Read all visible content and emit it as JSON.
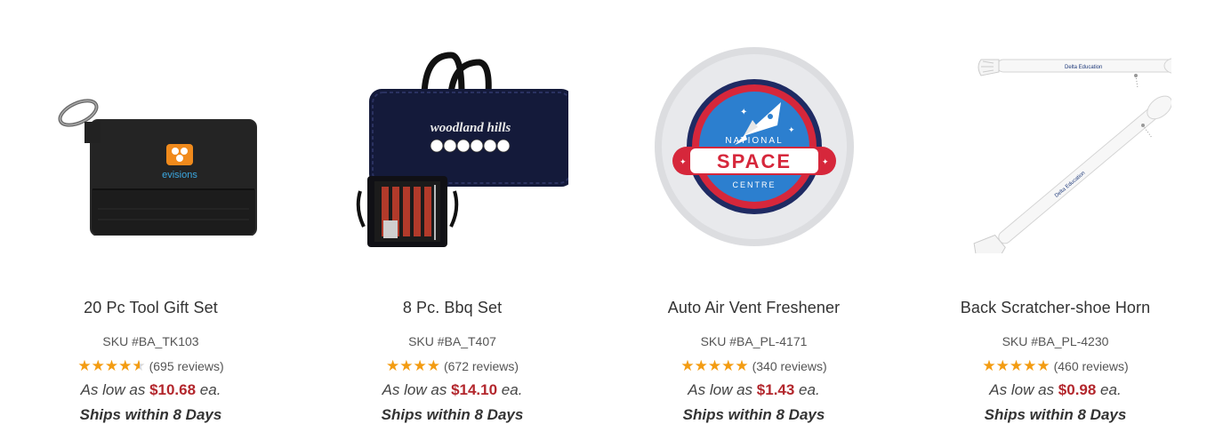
{
  "products": [
    {
      "title": "20 Pc Tool Gift Set",
      "sku": "SKU #BA_TK103",
      "rating": 4.5,
      "reviews": "(695 reviews)",
      "price_prefix": "As low as ",
      "price": "$10.68",
      "price_suffix": " ea.",
      "shipping": "Ships within 8 Days",
      "image_icon": "tool-pouch-image",
      "brand_text": "evisions"
    },
    {
      "title": "8 Pc. Bbq Set",
      "sku": "SKU #BA_T407",
      "rating": 4,
      "reviews": "(672 reviews)",
      "price_prefix": "As low as ",
      "price": "$14.10",
      "price_suffix": " ea.",
      "shipping": "Ships within 8 Days",
      "image_icon": "bbq-case-image",
      "brand_text": "woodland hills"
    },
    {
      "title": "Auto Air Vent Freshener",
      "sku": "SKU #BA_PL-4171",
      "rating": 5,
      "reviews": "(340 reviews)",
      "price_prefix": "As low as ",
      "price": "$1.43",
      "price_suffix": " ea.",
      "shipping": "Ships within 8 Days",
      "image_icon": "air-freshener-image",
      "brand_text_top": "NATIONAL",
      "brand_text_mid": "SPACE",
      "brand_text_bottom": "CENTRE"
    },
    {
      "title": "Back Scratcher-shoe Horn",
      "sku": "SKU #BA_PL-4230",
      "rating": 5,
      "reviews": "(460 reviews)",
      "price_prefix": "As low as ",
      "price": "$0.98",
      "price_suffix": " ea.",
      "shipping": "Ships within 8 Days",
      "image_icon": "back-scratcher-image",
      "brand_text": "Delta Education"
    }
  ],
  "colors": {
    "star": "#f39c12",
    "price": "#b3272d"
  }
}
